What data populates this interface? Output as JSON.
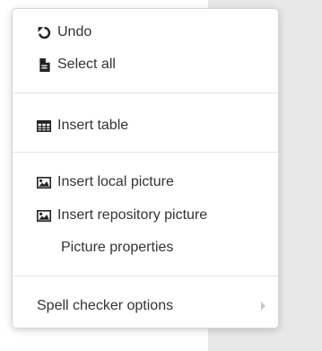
{
  "menu": {
    "undo": {
      "label": "Undo",
      "icon": "undo-icon"
    },
    "select_all": {
      "label": "Select all",
      "icon": "document-icon"
    },
    "insert_table": {
      "label": "Insert table",
      "icon": "table-icon"
    },
    "insert_local_picture": {
      "label": "Insert local picture",
      "icon": "image-icon"
    },
    "insert_repository_picture": {
      "label": "Insert repository picture",
      "icon": "image-icon"
    },
    "picture_properties": {
      "label": "Picture properties"
    },
    "spell_checker_options": {
      "label": "Spell checker options",
      "icon": "chevron-right-icon"
    }
  }
}
